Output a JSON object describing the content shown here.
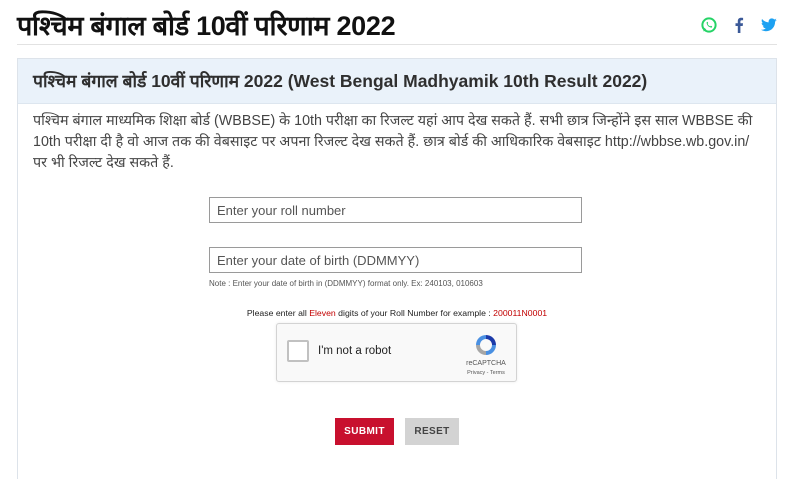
{
  "page": {
    "title": "पश्चिम बंगाल बोर्ड 10वीं परिणाम 2022"
  },
  "share": {
    "icons": [
      "whatsapp-icon",
      "facebook-icon",
      "twitter-icon"
    ],
    "colors": {
      "whatsapp": "#25d366",
      "facebook": "#3b5998",
      "twitter": "#1da1f2"
    }
  },
  "card": {
    "heading": "पश्चिम बंगाल बोर्ड 10वीं परिणाम 2022 (West Bengal Madhyamik 10th Result 2022)",
    "description": "पश्चिम बंगाल माध्यमिक शिक्षा बोर्ड (WBBSE) के 10th परीक्षा का रिजल्ट यहां आप देख सकते हैं. सभी छात्र जिन्होंने इस साल WBBSE की 10th परीक्षा दी है वो आज तक की वेबसाइट पर अपना रिजल्ट देख सकते हैं. छात्र बोर्ड की आधिकारिक वेबसाइट http://wbbse.wb.gov.in/ पर भी रिजल्ट देख सकते हैं."
  },
  "form": {
    "roll": {
      "placeholder": "Enter your roll number",
      "value": ""
    },
    "dob": {
      "placeholder": "Enter your date of birth (DDMMYY)",
      "value": ""
    },
    "note": "Note : Enter your date of birth in (DDMMYY) format only. Ex: 240103, 010603",
    "instruction": {
      "prefix": "Please enter all ",
      "highlight": "Eleven",
      "middle": " digits of your Roll Number for example : ",
      "example": "200011N0001"
    },
    "captcha": {
      "label": "I'm not a robot",
      "brand": "reCAPTCHA",
      "links": "Privacy - Terms"
    },
    "submit_label": "SUBMIT",
    "reset_label": "RESET"
  },
  "colors": {
    "accent_red": "#c8102e",
    "header_band": "#eaf2fa",
    "highlight_red": "#c20000"
  }
}
